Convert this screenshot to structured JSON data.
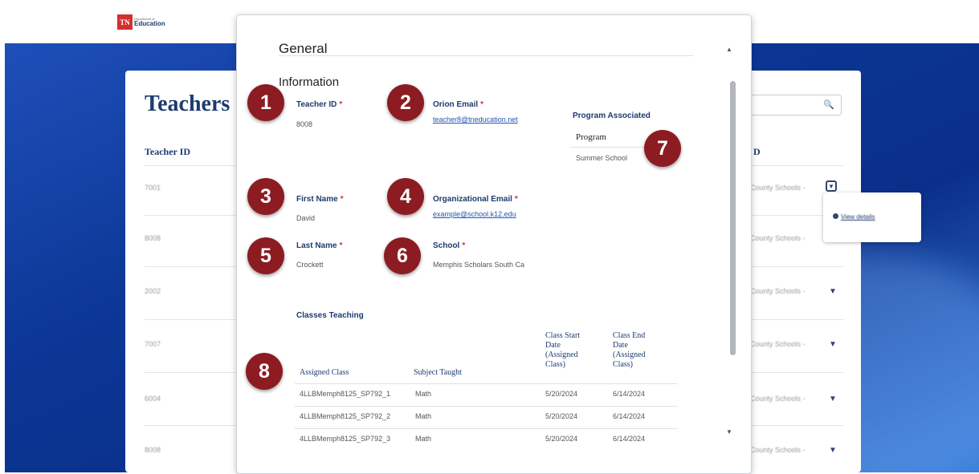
{
  "header": {
    "logo_abbr": "TN",
    "logo_small": "Department of",
    "logo_name": "Education"
  },
  "background_page": {
    "title": "Teachers",
    "search_icon": "search-icon",
    "columns": [
      "Teacher ID",
      "District"
    ],
    "rows": [
      {
        "id": "7001",
        "district": "County Schools -"
      },
      {
        "id": "8008",
        "district": "County Schools -"
      },
      {
        "id": "2002",
        "district": "County Schools -"
      },
      {
        "id": "7007",
        "district": "County Schools -"
      },
      {
        "id": "6004",
        "district": "County Schools -"
      },
      {
        "id": "8008",
        "district": "County Schools -"
      }
    ],
    "popover": {
      "view_details": "View details"
    }
  },
  "modal": {
    "title": "General",
    "section": "Information",
    "teacher_id": {
      "label": "Teacher ID",
      "value": "8008"
    },
    "orion_email": {
      "label": "Orion Email",
      "value": "teacher8@tneducation.net"
    },
    "first_name": {
      "label": "First Name",
      "value": "David"
    },
    "org_email": {
      "label": "Organizational Email",
      "value": "example@school.k12.edu"
    },
    "last_name": {
      "label": "Last Name",
      "value": "Crockett"
    },
    "school": {
      "label": "School",
      "value": "Memphis Scholars South Ca"
    },
    "program": {
      "label": "Program Associated",
      "column": "Program",
      "value": "Summer School"
    },
    "classes": {
      "label": "Classes Teaching",
      "headers": [
        "Assigned Class",
        "Subject Taught",
        "Class Start Date (Assigned Class)",
        "Class End Date (Assigned Class)"
      ],
      "rows": [
        [
          "4LLBMemph8125_SP792_1",
          "Math",
          "5/20/2024",
          "6/14/2024"
        ],
        [
          "4LLBMemph8125_SP792_2",
          "Math",
          "5/20/2024",
          "6/14/2024"
        ],
        [
          "4LLBMemph8125_SP792_3",
          "Math",
          "5/20/2024",
          "6/14/2024"
        ]
      ]
    },
    "required_mark": "*"
  },
  "badges": [
    "1",
    "2",
    "3",
    "4",
    "5",
    "6",
    "7",
    "8"
  ],
  "colors": {
    "badge": "#8c1c22",
    "label": "#1d3b6e",
    "required": "#d32f2f",
    "link": "#2456b4"
  }
}
